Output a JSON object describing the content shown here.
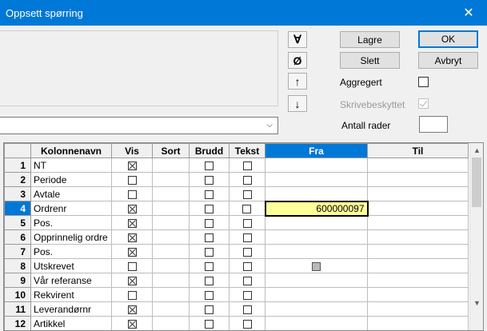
{
  "window": {
    "title": "Oppsett spørring",
    "close_glyph": "✕"
  },
  "tools": {
    "all_glyph": "∀",
    "empty_glyph": "Ø",
    "up_glyph": "↑",
    "down_glyph": "↓"
  },
  "buttons": {
    "save": "Lagre",
    "delete": "Slett",
    "ok": "OK",
    "cancel": "Avbryt"
  },
  "options": {
    "aggregated_label": "Aggregert",
    "aggregated_checked": false,
    "writeprotect_label": "Skrivebeskyttet",
    "writeprotect_checked": true,
    "rows_label": "Antall rader",
    "rows_value": ""
  },
  "dropdown": {
    "value": "",
    "arrow_glyph": "⌵"
  },
  "grid": {
    "headers": {
      "colname": "Kolonnenavn",
      "vis": "Vis",
      "sort": "Sort",
      "brudd": "Brudd",
      "tekst": "Tekst",
      "fra": "Fra",
      "til": "Til"
    },
    "active_row": 4,
    "active_column": "Fra",
    "rows": [
      {
        "num": "1",
        "name": "NT",
        "vis": true,
        "brudd": false,
        "tekst": false,
        "fra": "",
        "til": ""
      },
      {
        "num": "2",
        "name": "Periode",
        "vis": false,
        "brudd": false,
        "tekst": false,
        "fra": "",
        "til": ""
      },
      {
        "num": "3",
        "name": "Avtale",
        "vis": false,
        "brudd": false,
        "tekst": false,
        "fra": "",
        "til": ""
      },
      {
        "num": "4",
        "name": "Ordrenr",
        "vis": true,
        "brudd": false,
        "tekst": false,
        "fra": "600000097",
        "til": ""
      },
      {
        "num": "5",
        "name": "Pos.",
        "vis": true,
        "brudd": false,
        "tekst": false,
        "fra": "",
        "til": ""
      },
      {
        "num": "6",
        "name": "Opprinnelig ordre",
        "vis": true,
        "brudd": false,
        "tekst": false,
        "fra": "",
        "til": ""
      },
      {
        "num": "7",
        "name": "Pos.",
        "vis": true,
        "brudd": false,
        "tekst": false,
        "fra": "",
        "til": ""
      },
      {
        "num": "8",
        "name": "Utskrevet",
        "vis": false,
        "brudd": false,
        "tekst": false,
        "fra": "gray-checkbox",
        "til": ""
      },
      {
        "num": "9",
        "name": "Vår referanse",
        "vis": true,
        "brudd": false,
        "tekst": false,
        "fra": "",
        "til": ""
      },
      {
        "num": "10",
        "name": "Rekvirent",
        "vis": false,
        "brudd": false,
        "tekst": false,
        "fra": "",
        "til": ""
      },
      {
        "num": "11",
        "name": "Leverandørnr",
        "vis": true,
        "brudd": false,
        "tekst": false,
        "fra": "",
        "til": ""
      },
      {
        "num": "12",
        "name": "Artikkel",
        "vis": true,
        "brudd": false,
        "tekst": false,
        "fra": "",
        "til": ""
      }
    ]
  },
  "scrollbar": {
    "up_glyph": "▲",
    "down_glyph": "▼"
  }
}
